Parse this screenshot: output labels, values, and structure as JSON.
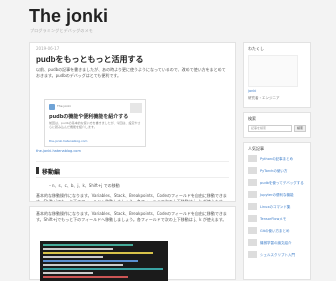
{
  "site": {
    "title": "The jonki",
    "subtitle": "プログラミングとデバッグのメモ"
  },
  "post": {
    "date": "2019-06-17",
    "title": "pudbをもっともっと活用する",
    "intro": "以前、pudbの記事を書きましたが、あの時より更に使うようになっているので、改めて使い方をまとめておきます。pudbのデバッグはとても便利です。",
    "embed": {
      "site": "The jonki",
      "title": "pudbの機能や便利機能を紹介する",
      "desc": "前回は、pudbの基本的な使い方を書きましたが、今回は、設定やさらに踏み込んだ機能を紹介します。",
      "link": "the-jonki.hatenablog.com"
    },
    "permalink": "the-jonki.hatenablog.com",
    "section_title": "移動編",
    "bullet": "n、s、c、b、j、k、Shift+j での移動",
    "body": "基本的な移動操作になります。Variables、Stack、Breakpoints、Codeのフィールドを自由に移動できます。Shift+jでもっと下のフィールドへ移動しましょう。各フィールドで次の上下移動は j、k が使えます。"
  },
  "sidebar": {
    "about_title": "わたくし",
    "about_link": "jonki",
    "about_text": "研究者・エンジニア",
    "search_title": "検索",
    "search_placeholder": "記事を検索",
    "search_button": "検索",
    "popular_title": "人気記事",
    "popular": [
      "Pythonの記事まとめ",
      "PyTorchの使い方",
      "pudbを使ってデバッグする",
      "Jupyterの便利な機能",
      "Linuxのコマンド集",
      "TensorFlowメモ",
      "Gitの使い方まとめ",
      "機械学習の論文紹介",
      "シェルスクリプト入門"
    ]
  }
}
